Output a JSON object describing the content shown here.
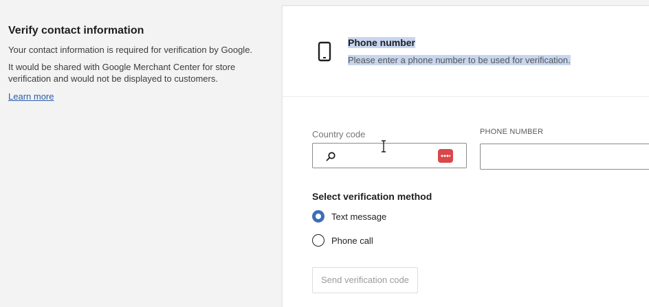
{
  "info": {
    "title": "Verify contact information",
    "paragraph1": "Your contact information is required for verification by Google.",
    "paragraph2": "It would be shared with Google Merchant Center for store verification and would not be displayed to customers.",
    "learn_more": "Learn more"
  },
  "phone_section": {
    "icon": "smartphone-icon",
    "title": "Phone number",
    "subtitle": "Please enter a phone number to be used for verification."
  },
  "form": {
    "country_label": "Country code",
    "country_value": "",
    "phone_label": "PHONE NUMBER",
    "phone_value": "",
    "method_title": "Select verification method",
    "methods": [
      {
        "label": "Text message",
        "selected": true
      },
      {
        "label": "Phone call",
        "selected": false
      }
    ],
    "send_button": "Send verification code"
  },
  "colors": {
    "accent": "#3d6fb6",
    "selection_highlight": "#c7d5ef",
    "extension_badge": "#d9474b"
  }
}
